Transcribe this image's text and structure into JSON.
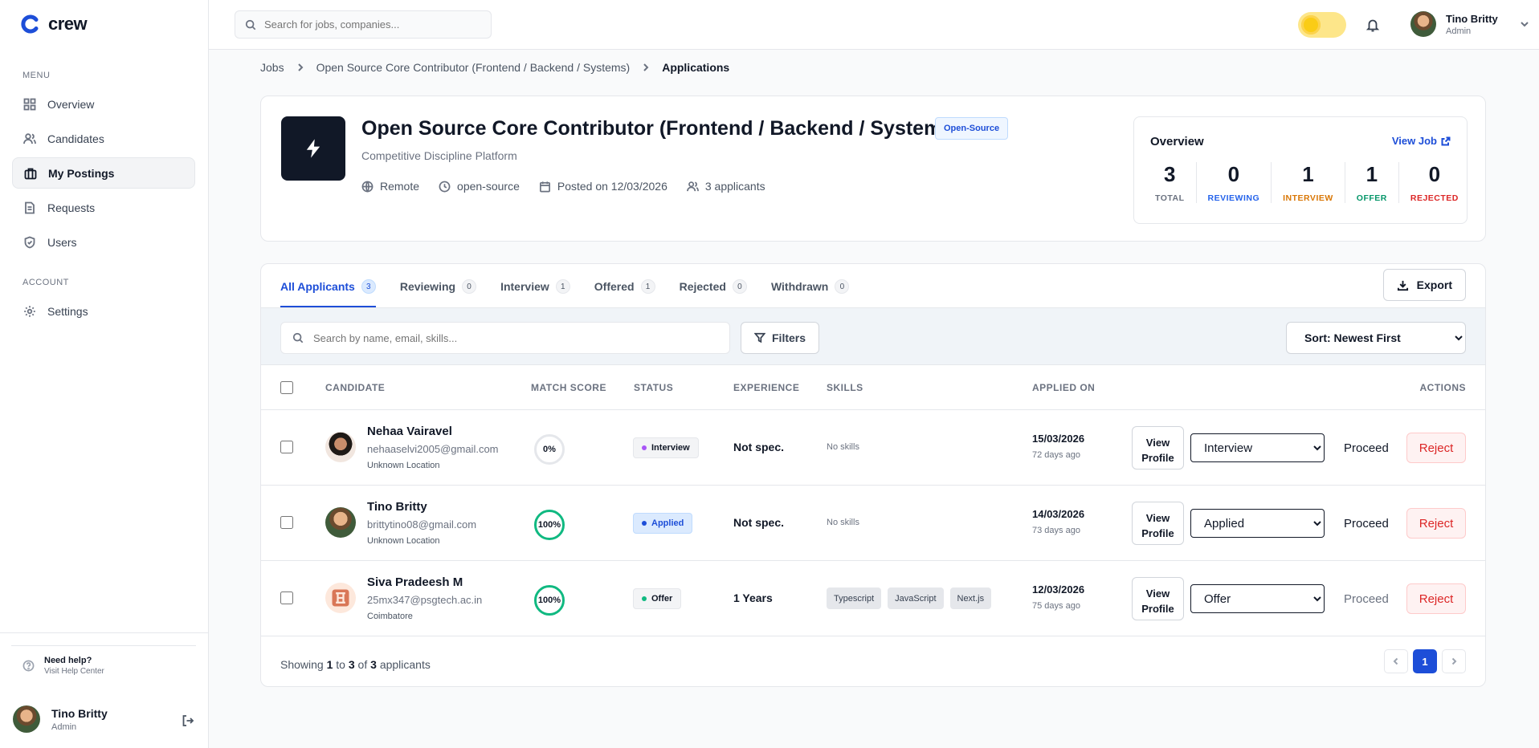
{
  "brand": {
    "name": "crew"
  },
  "sidebar": {
    "menu_label": "MENU",
    "account_label": "ACCOUNT",
    "items": [
      {
        "label": "Overview",
        "icon": "grid-icon"
      },
      {
        "label": "Candidates",
        "icon": "users-icon"
      },
      {
        "label": "My Postings",
        "icon": "briefcase-icon",
        "active": true
      },
      {
        "label": "Requests",
        "icon": "document-icon"
      },
      {
        "label": "Users",
        "icon": "shield-icon"
      }
    ],
    "account_items": [
      {
        "label": "Settings",
        "icon": "gear-icon"
      }
    ],
    "help": {
      "title": "Need help?",
      "subtitle": "Visit Help Center"
    },
    "user": {
      "name": "Tino Britty",
      "role": "Admin"
    }
  },
  "topbar": {
    "search_placeholder": "Search for jobs, companies...",
    "user": {
      "name": "Tino Britty",
      "role": "Admin"
    }
  },
  "breadcrumb": [
    "Jobs",
    "Open Source Core Contributor (Frontend / Backend / Systems)",
    "Applications"
  ],
  "job": {
    "title": "Open Source Core Contributor (Frontend / Backend / Systems)",
    "badge": "Open-Source",
    "company": "Competitive Discipline Platform",
    "location": "Remote",
    "type": "open-source",
    "posted": "Posted on 12/03/2026",
    "applicants": "3 applicants"
  },
  "overview": {
    "title": "Overview",
    "view_job": "View Job",
    "stats": [
      {
        "num": "3",
        "label": "TOTAL",
        "color": "#6b7280"
      },
      {
        "num": "0",
        "label": "REVIEWING",
        "color": "#2563eb"
      },
      {
        "num": "1",
        "label": "INTERVIEW",
        "color": "#d97706"
      },
      {
        "num": "1",
        "label": "OFFER",
        "color": "#059669"
      },
      {
        "num": "0",
        "label": "REJECTED",
        "color": "#dc2626"
      }
    ]
  },
  "tabs": [
    {
      "label": "All Applicants",
      "count": "3",
      "active": true
    },
    {
      "label": "Reviewing",
      "count": "0"
    },
    {
      "label": "Interview",
      "count": "1"
    },
    {
      "label": "Offered",
      "count": "1"
    },
    {
      "label": "Rejected",
      "count": "0"
    },
    {
      "label": "Withdrawn",
      "count": "0"
    }
  ],
  "export_label": "Export",
  "list": {
    "search_placeholder": "Search by name, email, skills...",
    "filters_label": "Filters",
    "sort_label": "Sort: Newest First"
  },
  "columns": {
    "candidate": "CANDIDATE",
    "match": "MATCH SCORE",
    "status": "STATUS",
    "experience": "EXPERIENCE",
    "skills": "SKILLS",
    "applied": "APPLIED ON",
    "actions": "ACTIONS"
  },
  "rows": [
    {
      "name": "Nehaa Vairavel",
      "email": "nehaaselvi2005@gmail.com",
      "location": "Unknown Location",
      "score": "0%",
      "status": "Interview",
      "experience": "Not spec.",
      "skills_text": "No skills",
      "skills": [],
      "date": "15/03/2026",
      "ago": "72 days ago",
      "select": "Interview"
    },
    {
      "name": "Tino Britty",
      "email": "brittytino08@gmail.com",
      "location": "Unknown Location",
      "score": "100%",
      "status": "Applied",
      "experience": "Not spec.",
      "skills_text": "No skills",
      "skills": [],
      "date": "14/03/2026",
      "ago": "73 days ago",
      "select": "Applied"
    },
    {
      "name": "Siva Pradeesh M",
      "email": "25mx347@psgtech.ac.in",
      "location": "Coimbatore",
      "score": "100%",
      "status": "Offer",
      "experience": "1 Years",
      "skills_text": "",
      "skills": [
        "Typescript",
        "JavaScript",
        "Next.js"
      ],
      "date": "12/03/2026",
      "ago": "75 days ago",
      "select": "Offer"
    }
  ],
  "row_actions": {
    "view_profile_1": "View",
    "view_profile_2": "Profile",
    "proceed": "Proceed",
    "reject": "Reject"
  },
  "footer": {
    "pre": "Showing",
    "from": "1",
    "to_word": "to",
    "to": "3",
    "of_word": "of",
    "total": "3",
    "post": "applicants",
    "page": "1"
  }
}
